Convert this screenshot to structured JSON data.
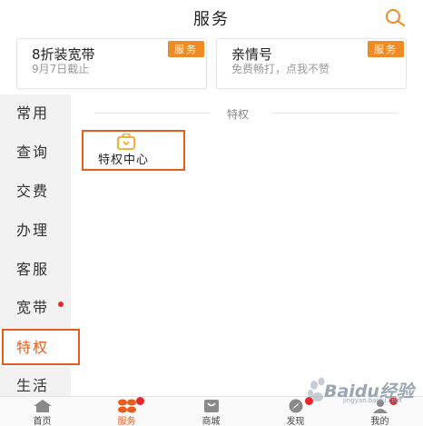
{
  "header": {
    "title": "服务",
    "search_icon": "search-icon",
    "accent": "#f08a24"
  },
  "cards": [
    {
      "title": "8折装宽带",
      "subtitle": "9月7日截止",
      "tag": "服务"
    },
    {
      "title": "亲情号",
      "subtitle": "免费畅打，点我不赞",
      "tag": "服务"
    }
  ],
  "sidebar": {
    "items": [
      {
        "label": "常用"
      },
      {
        "label": "查询"
      },
      {
        "label": "交费"
      },
      {
        "label": "办理"
      },
      {
        "label": "客服"
      },
      {
        "label": "宽带",
        "badge": true
      },
      {
        "label": "特权",
        "active": true
      },
      {
        "label": "生活"
      }
    ]
  },
  "section": {
    "label": "特权"
  },
  "tile": {
    "label": "特权中心",
    "icon": "privilege-bag-icon"
  },
  "tabbar": {
    "tabs": [
      {
        "label": "首页",
        "icon": "home-icon"
      },
      {
        "label": "服务",
        "icon": "service-grid-icon",
        "active": true,
        "badge": true
      },
      {
        "label": "商城",
        "icon": "mall-bag-icon"
      },
      {
        "label": "发现",
        "icon": "compass-icon",
        "badge": true
      },
      {
        "label": "我的",
        "icon": "user-icon",
        "badge": true
      }
    ]
  },
  "watermark": {
    "text": "Baidu经验",
    "sub": "jingyan.baidu.com"
  },
  "colors": {
    "accent": "#e85d1c",
    "badge": "#e8262b",
    "tag": "#f08a24"
  }
}
